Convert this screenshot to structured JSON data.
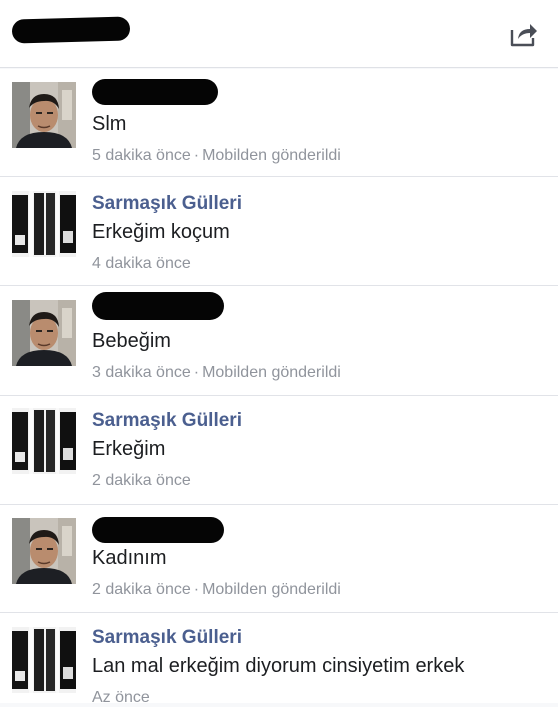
{
  "header": {
    "title_redacted": true,
    "share_icon": "share-icon"
  },
  "messages": [
    {
      "sender": "",
      "sender_redacted": true,
      "avatar": "man-photo-avatar",
      "text": "Slm",
      "time": "5 dakika önce",
      "source": "Mobilden gönderildi"
    },
    {
      "sender": "Sarmaşık Gülleri",
      "sender_redacted": false,
      "avatar": "shop-photo-avatar",
      "text": "Erkeğim koçum",
      "time": "4 dakika önce",
      "source": ""
    },
    {
      "sender": "",
      "sender_redacted": true,
      "avatar": "man-photo-avatar",
      "text": "Bebeğim",
      "time": "3 dakika önce",
      "source": "Mobilden gönderildi"
    },
    {
      "sender": "Sarmaşık Gülleri",
      "sender_redacted": false,
      "avatar": "shop-photo-avatar",
      "text": "Erkeğim",
      "time": "2 dakika önce",
      "source": ""
    },
    {
      "sender": "",
      "sender_redacted": true,
      "avatar": "man-photo-avatar",
      "text": "Kadınım",
      "time": "2 dakika önce",
      "source": "Mobilden gönderildi"
    },
    {
      "sender": "Sarmaşık Gülleri",
      "sender_redacted": false,
      "avatar": "shop-photo-avatar",
      "text": "Lan mal erkeğim diyorum cinsiyetim erkek",
      "time": "Az önce",
      "source": ""
    }
  ],
  "colors": {
    "sender_name": "#4b5f8f",
    "message_text": "#1c1e21",
    "meta_text": "#90949c",
    "redaction": "#050505"
  }
}
